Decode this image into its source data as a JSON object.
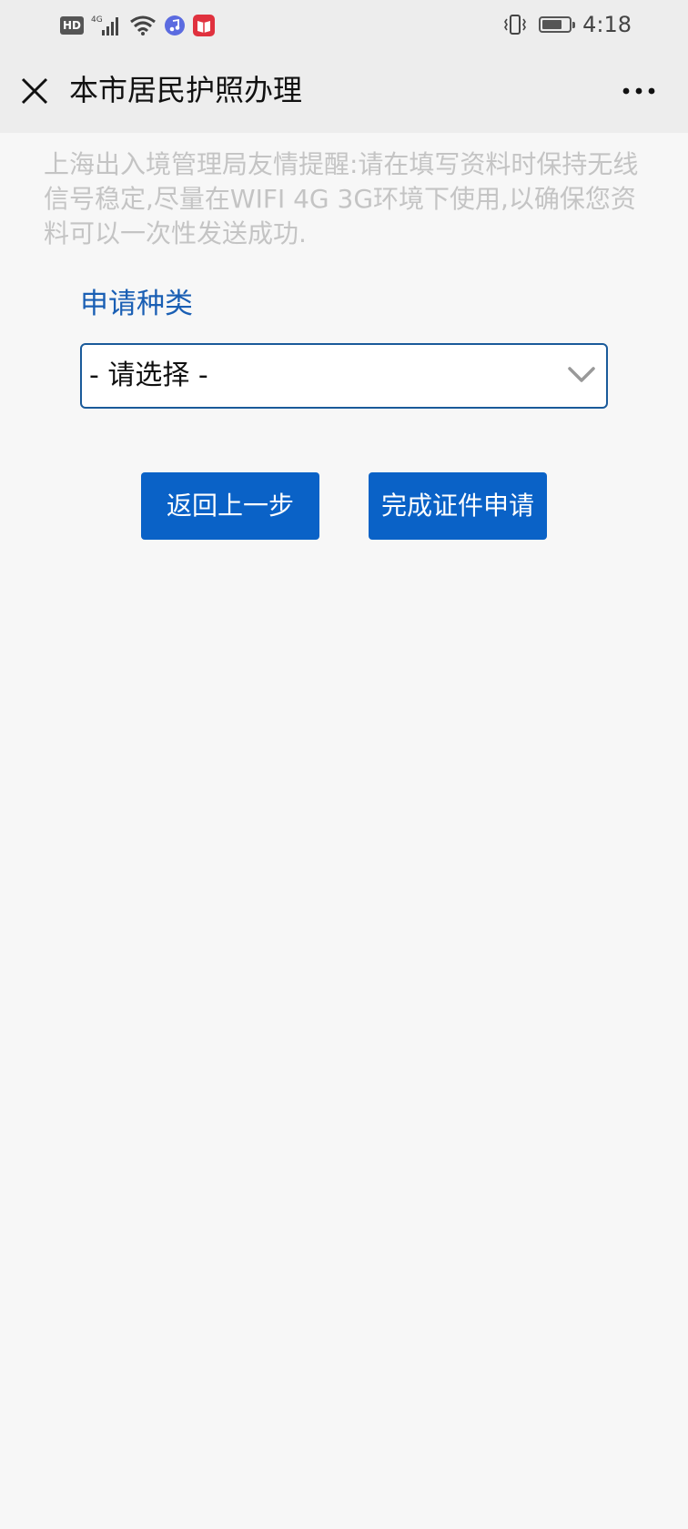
{
  "status_bar": {
    "network_badge": "HD",
    "network_type": "4G",
    "time": "4:18",
    "battery_level": 0.75,
    "icons": [
      "hd-icon",
      "signal-icon",
      "wifi-icon",
      "music-app-icon",
      "book-app-icon",
      "vibrate-icon",
      "battery-icon"
    ]
  },
  "nav": {
    "title": "本市居民护照办理",
    "close_icon": "close-icon",
    "more_icon": "more-icon"
  },
  "notice": {
    "text": "上海出入境管理局友情提醒:请在填写资料时保持无线信号稳定,尽量在WIFI 4G 3G环境下使用,以确保您资料可以一次性发送成功."
  },
  "form": {
    "label": "申请种类",
    "select_value": "- 请选择 -"
  },
  "buttons": {
    "back_label": "返回上一步",
    "submit_label": "完成证件申请"
  },
  "colors": {
    "primary": "#0a62c7",
    "label": "#1a5fb4",
    "notice": "#c4c4c4",
    "header_bg": "#ededed",
    "page_bg": "#f7f7f7"
  }
}
